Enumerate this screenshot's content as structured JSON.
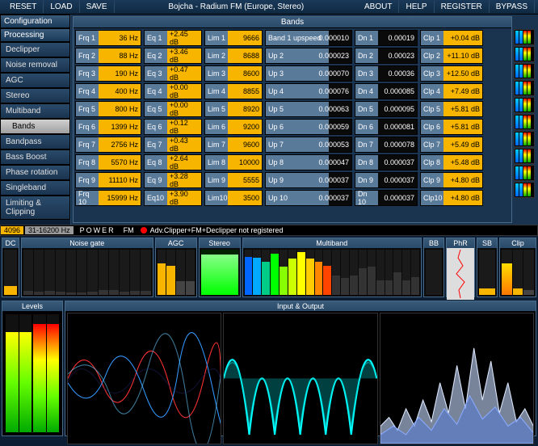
{
  "menu": {
    "reset": "RESET",
    "load": "LOAD",
    "save": "SAVE",
    "about": "ABOUT",
    "help": "HELP",
    "register": "REGISTER",
    "bypass": "BYPASS",
    "preset": "Bojcha - Radium FM (Europe, Stereo)"
  },
  "sidebar": {
    "configuration": "Configuration",
    "processing": "Processing",
    "items": [
      "Declipper",
      "Noise removal",
      "AGC",
      "Stereo",
      "Multiband",
      "Bands",
      "Bandpass",
      "Bass Boost",
      "Phase rotation",
      "Singleband",
      "Limiting & Clipping"
    ]
  },
  "bands": {
    "title": "Bands",
    "upspeed_label": "Band 1 upspeed",
    "rows": [
      {
        "frqL": "Frq 1",
        "frqV": "36 Hz",
        "eqL": "Eq 1",
        "eqV": "+2.45 dB",
        "limL": "Lim 1",
        "limV": "9666",
        "upV": "0.000010",
        "dnL": "Dn 1",
        "dnV": "0.00019",
        "clpL": "Clp 1",
        "clpV": "+0.04 dB"
      },
      {
        "frqL": "Frq 2",
        "frqV": "88 Hz",
        "eqL": "Eq 2",
        "eqV": "+3.46 dB",
        "limL": "Lim 2",
        "limV": "8688",
        "upL": "Up 2",
        "upV": "0.000023",
        "dnL": "Dn 2",
        "dnV": "0.00023",
        "clpL": "Clp 2",
        "clpV": "+11.10 dB"
      },
      {
        "frqL": "Frq 3",
        "frqV": "190 Hz",
        "eqL": "Eq 3",
        "eqV": "+0.47 dB",
        "limL": "Lim 3",
        "limV": "8600",
        "upL": "Up 3",
        "upV": "0.000070",
        "dnL": "Dn 3",
        "dnV": "0.00036",
        "clpL": "Clp 3",
        "clpV": "+12.50 dB"
      },
      {
        "frqL": "Frq 4",
        "frqV": "400 Hz",
        "eqL": "Eq 4",
        "eqV": "+0.00 dB",
        "limL": "Lim 4",
        "limV": "8855",
        "upL": "Up 4",
        "upV": "0.000076",
        "dnL": "Dn 4",
        "dnV": "0.000085",
        "clpL": "Clp 4",
        "clpV": "+7.49 dB"
      },
      {
        "frqL": "Frq 5",
        "frqV": "800 Hz",
        "eqL": "Eq 5",
        "eqV": "+0.00 dB",
        "limL": "Lim 5",
        "limV": "8920",
        "upL": "Up 5",
        "upV": "0.000063",
        "dnL": "Dn 5",
        "dnV": "0.000095",
        "clpL": "Clp 5",
        "clpV": "+5.81 dB"
      },
      {
        "frqL": "Frq 6",
        "frqV": "1399 Hz",
        "eqL": "Eq 6",
        "eqV": "+0.12 dB",
        "limL": "Lim 6",
        "limV": "9200",
        "upL": "Up 6",
        "upV": "0.000059",
        "dnL": "Dn 6",
        "dnV": "0.000081",
        "clpL": "Clp 6",
        "clpV": "+5.81 dB"
      },
      {
        "frqL": "Frq 7",
        "frqV": "2756 Hz",
        "eqL": "Eq 7",
        "eqV": "+0.43 dB",
        "limL": "Lim 7",
        "limV": "9600",
        "upL": "Up 7",
        "upV": "0.000053",
        "dnL": "Dn 7",
        "dnV": "0.000078",
        "clpL": "Clp 7",
        "clpV": "+5.49 dB"
      },
      {
        "frqL": "Frq 8",
        "frqV": "5570 Hz",
        "eqL": "Eq 8",
        "eqV": "+2.64 dB",
        "limL": "Lim 8",
        "limV": "10000",
        "upL": "Up 8",
        "upV": "0.000047",
        "dnL": "Dn 8",
        "dnV": "0.000037",
        "clpL": "Clp 8",
        "clpV": "+5.48 dB"
      },
      {
        "frqL": "Frq 9",
        "frqV": "11110 Hz",
        "eqL": "Eq 9",
        "eqV": "+3.28 dB",
        "limL": "Lim 9",
        "limV": "5555",
        "upL": "Up 9",
        "upV": "0.000037",
        "dnL": "Dn 9",
        "dnV": "0.000037",
        "clpL": "Clp 9",
        "clpV": "+4.80 dB"
      },
      {
        "frqL": "Frq 10",
        "frqV": "15999 Hz",
        "eqL": "Eq10",
        "eqV": "+3.90 dB",
        "limL": "Lim10",
        "limV": "3500",
        "upL": "Up 10",
        "upV": "0.000037",
        "dnL": "Dn 10",
        "dnV": "0.000037",
        "clpL": "Clp10",
        "clpV": "+4.80 dB"
      }
    ]
  },
  "status": {
    "left": "4096",
    "rate": "31-16200 Hz",
    "logo": "POWER",
    "fm": "FM",
    "warn": "Adv.Clipper+FM+Declipper not registered"
  },
  "meters": {
    "dc": "DC",
    "noise": "Noise gate",
    "agc": "AGC",
    "stereo": "Stereo",
    "multiband": "Multiband",
    "bb": "BB",
    "phr": "PhR",
    "sb": "SB",
    "clip": "Clip"
  },
  "bottom": {
    "levels": "Levels",
    "io": "Input & Output"
  }
}
